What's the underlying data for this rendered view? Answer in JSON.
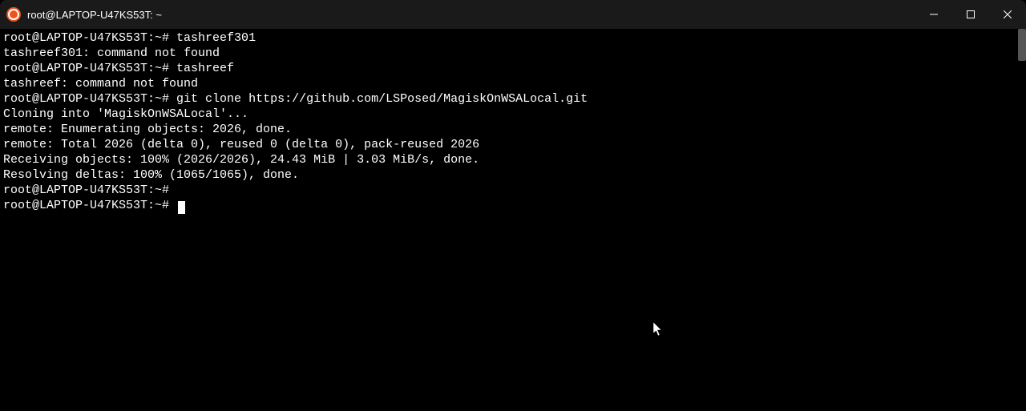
{
  "window": {
    "title": "root@LAPTOP-U47KS53T: ~"
  },
  "terminal": {
    "lines": [
      {
        "prompt": "root@LAPTOP-U47KS53T:~#",
        "command": " tashreef301"
      },
      {
        "output": "tashreef301: command not found"
      },
      {
        "prompt": "root@LAPTOP-U47KS53T:~#",
        "command": " tashreef"
      },
      {
        "output": "tashreef: command not found"
      },
      {
        "prompt": "root@LAPTOP-U47KS53T:~#",
        "command": " git clone https://github.com/LSPosed/MagiskOnWSALocal.git"
      },
      {
        "output": "Cloning into 'MagiskOnWSALocal'..."
      },
      {
        "output": ""
      },
      {
        "output": "remote: Enumerating objects: 2026, done."
      },
      {
        "output": "remote: Total 2026 (delta 0), reused 0 (delta 0), pack-reused 2026"
      },
      {
        "output": "Receiving objects: 100% (2026/2026), 24.43 MiB | 3.03 MiB/s, done."
      },
      {
        "output": "Resolving deltas: 100% (1065/1065), done."
      },
      {
        "prompt": "root@LAPTOP-U47KS53T:~#",
        "command": ""
      },
      {
        "prompt": "root@LAPTOP-U47KS53T:~#",
        "command": " ",
        "cursor": true
      }
    ]
  }
}
